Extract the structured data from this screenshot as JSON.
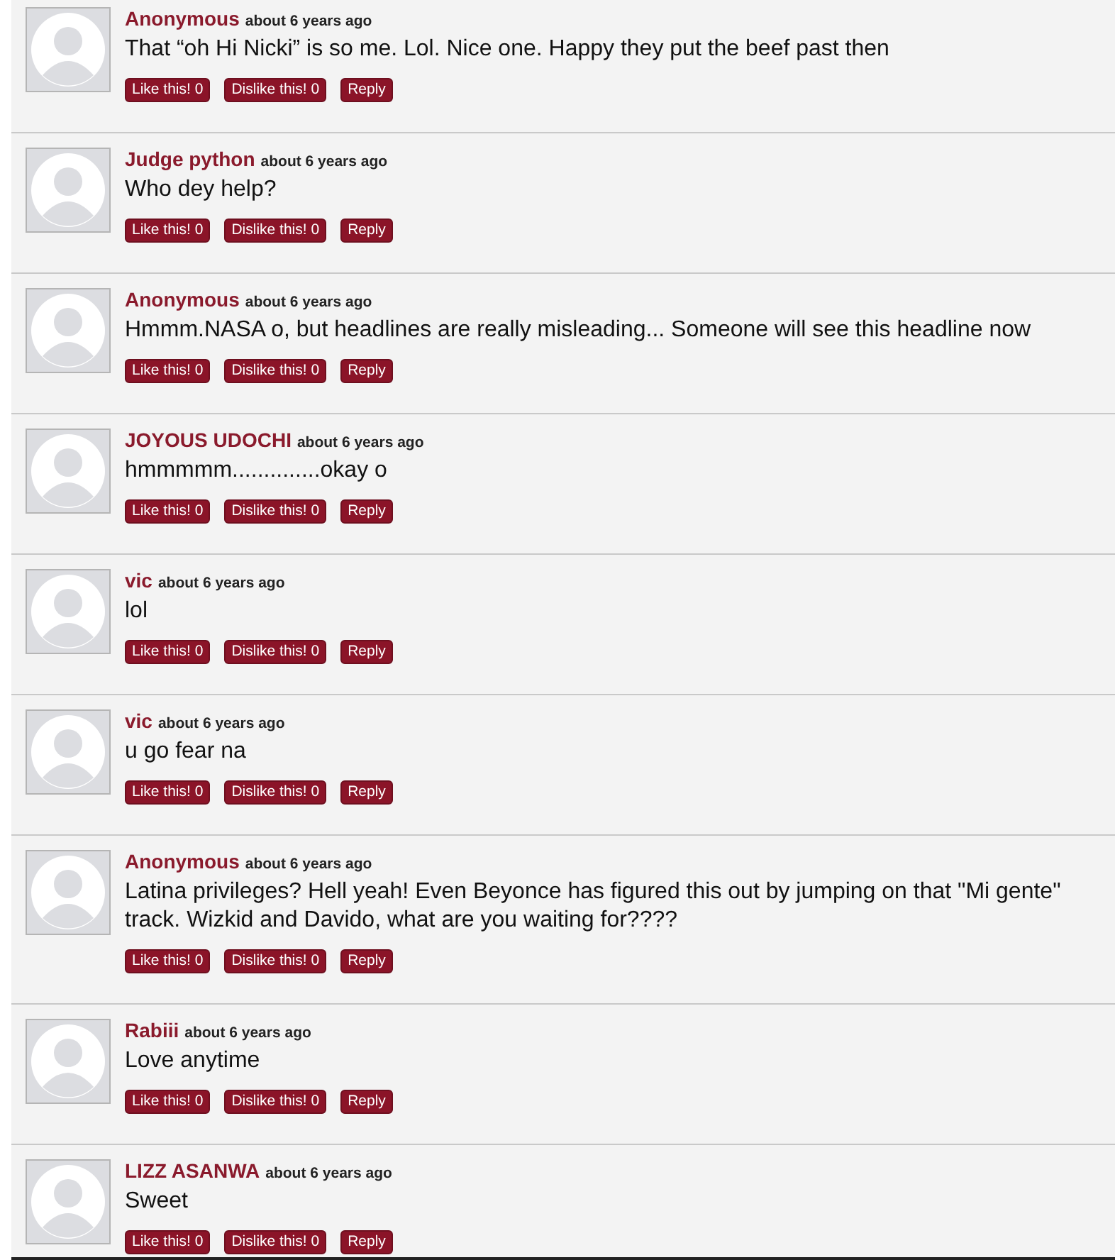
{
  "comments": [
    {
      "author": "Anonymous",
      "time": "about 6 years ago",
      "text": "That “oh Hi Nicki” is so me. Lol. Nice one. Happy they put the beef past then",
      "like": "Like this! 0",
      "dislike": "Dislike this! 0",
      "reply": "Reply"
    },
    {
      "author": "Judge python",
      "time": "about 6 years ago",
      "text": "Who dey help?",
      "like": "Like this! 0",
      "dislike": "Dislike this! 0",
      "reply": "Reply"
    },
    {
      "author": "Anonymous",
      "time": "about 6 years ago",
      "text": "Hmmm.NASA o, but headlines are really misleading... Someone will see this headline now",
      "like": "Like this! 0",
      "dislike": "Dislike this! 0",
      "reply": "Reply"
    },
    {
      "author": "JOYOUS UDOCHI",
      "time": "about 6 years ago",
      "text": "hmmmmm..............okay o",
      "like": "Like this! 0",
      "dislike": "Dislike this! 0",
      "reply": "Reply"
    },
    {
      "author": "vic",
      "time": "about 6 years ago",
      "text": "lol",
      "like": "Like this! 0",
      "dislike": "Dislike this! 0",
      "reply": "Reply"
    },
    {
      "author": "vic",
      "time": "about 6 years ago",
      "text": "u go fear na",
      "like": "Like this! 0",
      "dislike": "Dislike this! 0",
      "reply": "Reply"
    },
    {
      "author": "Anonymous",
      "time": "about 6 years ago",
      "text": "Latina privileges? Hell yeah! Even Beyonce has figured this out by jumping on that \"Mi gente\" track. Wizkid and Davido, what are you waiting for????",
      "like": "Like this! 0",
      "dislike": "Dislike this! 0",
      "reply": "Reply"
    },
    {
      "author": "Rabiii",
      "time": "about 6 years ago",
      "text": "Love anytime",
      "like": "Like this! 0",
      "dislike": "Dislike this! 0",
      "reply": "Reply"
    },
    {
      "author": "LIZZ ASANWA",
      "time": "about 6 years ago",
      "text": "Sweet",
      "like": "Like this! 0",
      "dislike": "Dislike this! 0",
      "reply": "Reply"
    }
  ]
}
